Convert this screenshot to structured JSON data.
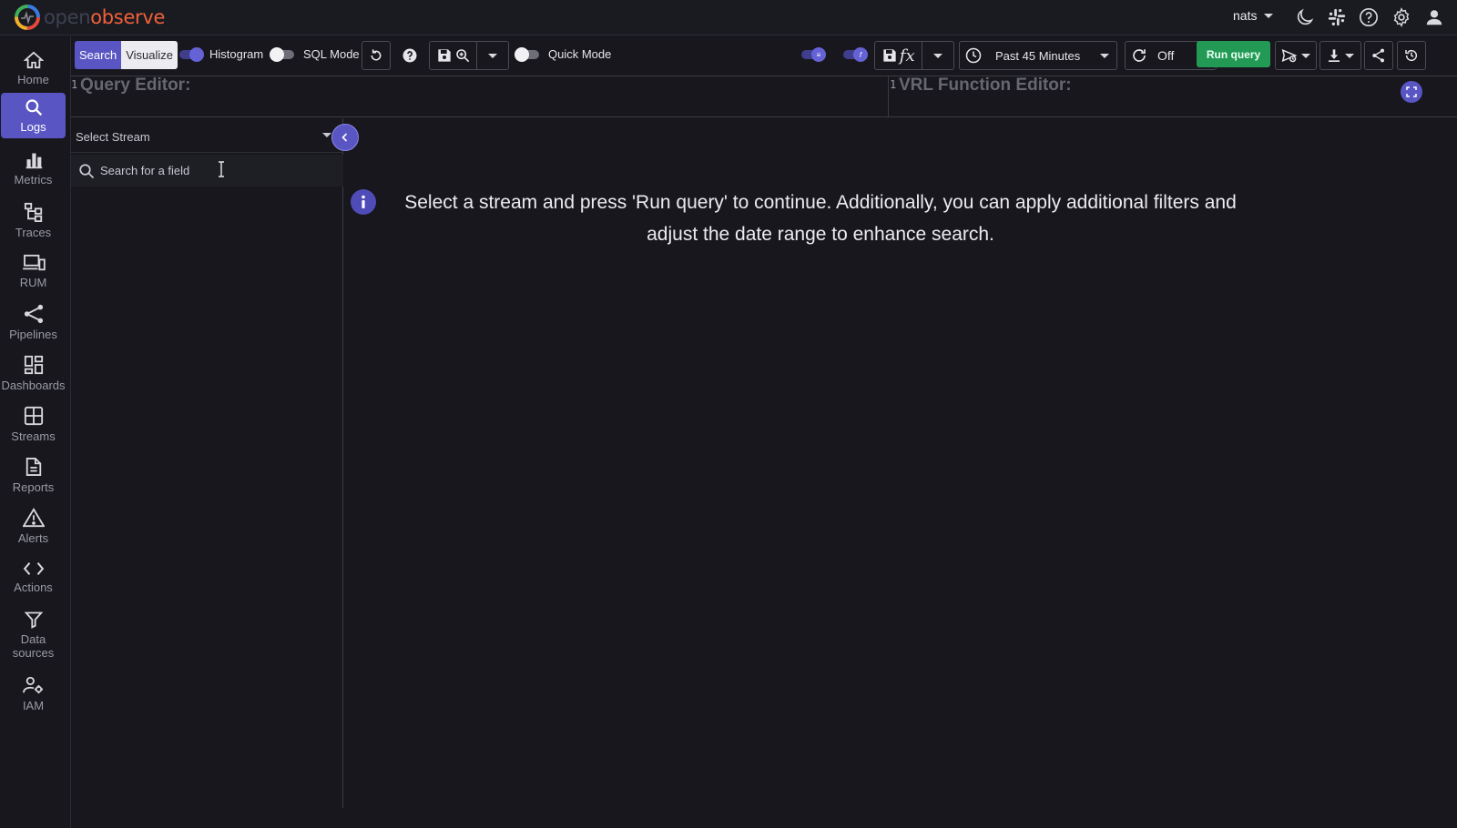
{
  "app": {
    "logo_text_open": "open",
    "logo_text_observe": "observe",
    "organization": "nats"
  },
  "header_icons": [
    "moon-icon",
    "slack-icon",
    "help-icon",
    "settings-icon",
    "user-icon"
  ],
  "sidebar": {
    "items": [
      {
        "label": "Home",
        "icon": "home-icon",
        "active": false
      },
      {
        "label": "Logs",
        "icon": "search-icon",
        "active": true
      },
      {
        "label": "Metrics",
        "icon": "bar-chart-icon",
        "active": false
      },
      {
        "label": "Traces",
        "icon": "traces-icon",
        "active": false
      },
      {
        "label": "RUM",
        "icon": "devices-icon",
        "active": false
      },
      {
        "label": "Pipelines",
        "icon": "pipelines-icon",
        "active": false
      },
      {
        "label": "Dashboards",
        "icon": "dashboard-icon",
        "active": false
      },
      {
        "label": "Streams",
        "icon": "grid-icon",
        "active": false
      },
      {
        "label": "Reports",
        "icon": "document-icon",
        "active": false
      },
      {
        "label": "Alerts",
        "icon": "warning-icon",
        "active": false
      },
      {
        "label": "Actions",
        "icon": "code-icon",
        "active": false
      },
      {
        "label": "Data sources",
        "icon": "filter-icon",
        "active": false
      },
      {
        "label": "IAM",
        "icon": "user-gear-icon",
        "active": false
      }
    ]
  },
  "toolbar": {
    "search_tab": "Search",
    "visualize_tab": "Visualize",
    "histogram_label": "Histogram",
    "histogram_on": true,
    "sql_mode_label": "SQL Mode",
    "sql_mode_on": false,
    "quick_mode_label": "Quick Mode",
    "quick_mode_on": false,
    "time_range": "Past 45 Minutes",
    "refresh_interval": "Off",
    "run_query_label": "Run query"
  },
  "editors": {
    "query_line_number": "1",
    "query_placeholder": "Query Editor:",
    "vrl_line_number": "1",
    "vrl_placeholder": "VRL Function Editor:"
  },
  "field_panel": {
    "stream_placeholder": "Select Stream",
    "field_search_placeholder": "Search for a field"
  },
  "empty_state": {
    "message": "Select a stream and press 'Run query' to continue. Additionally, you can apply additional filters and adjust the date range to enhance search."
  },
  "colors": {
    "accent": "#5956c4",
    "run_button": "#229a56",
    "background": "#17171d",
    "logo_observe": "#f1613a"
  }
}
